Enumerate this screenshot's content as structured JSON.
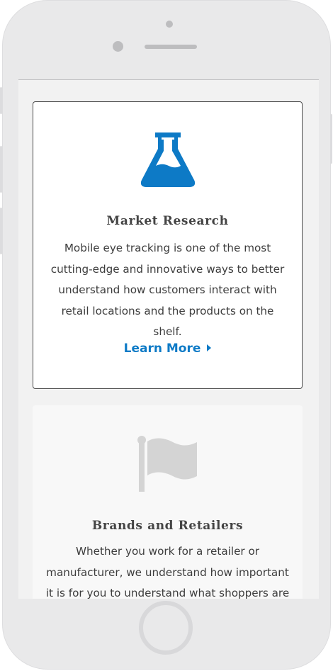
{
  "device": {
    "frame_color": "#e9e9ea",
    "home_button_icon": "home-button-ring"
  },
  "cards": [
    {
      "icon": "flask-icon",
      "icon_color": "#0d7ac6",
      "title": "Market Research",
      "description": "Mobile eye tracking is one of the most cutting-edge and innovative ways to better understand how customers interact with retail locations and the products on the shelf.",
      "link_label": "Learn More",
      "link_icon": "caret-right-icon"
    },
    {
      "icon": "flag-icon",
      "icon_color": "#d4d4d4",
      "title": "Brands and Retailers",
      "description": "Whether you work for a retailer or manufacturer, we understand how important it is for you to understand what shoppers are"
    }
  ],
  "colors": {
    "accent": "#0d7ac6",
    "title_text": "#444444",
    "body_text": "#3d3d3d"
  }
}
